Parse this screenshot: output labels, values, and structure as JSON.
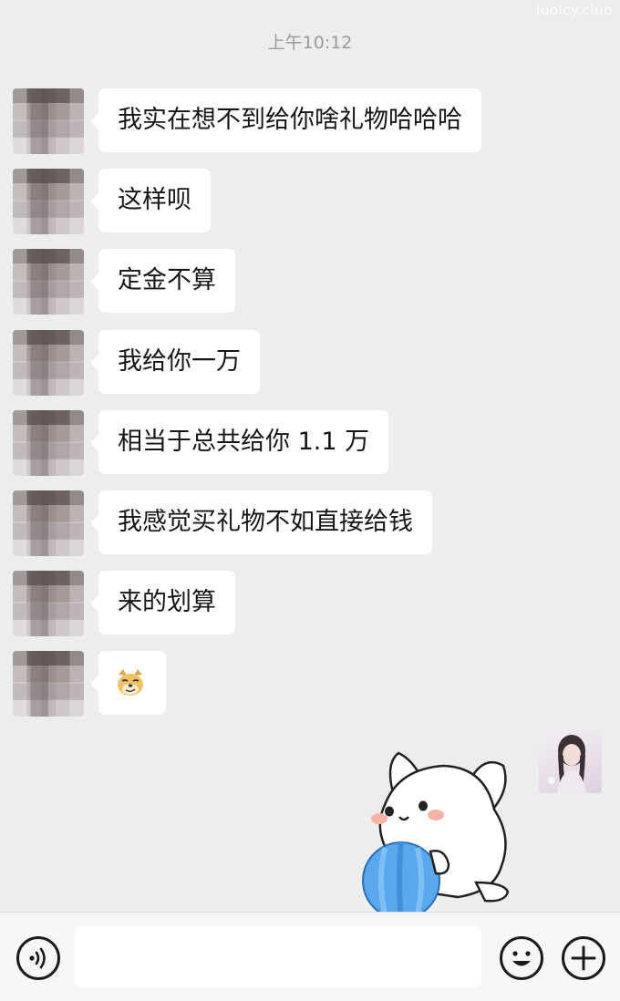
{
  "watermark": "luolcy.club",
  "timestamp": "上午10:12",
  "messages": [
    {
      "text": "我实在想不到给你啥礼物哈哈哈"
    },
    {
      "text": "这样呗"
    },
    {
      "text": "定金不算"
    },
    {
      "text": "我给你一万"
    },
    {
      "text": "相当于总共给你 1.1 万"
    },
    {
      "text": "我感觉买礼物不如直接给钱"
    },
    {
      "text": "来的划算"
    },
    {
      "sticker": "doge-emoji"
    }
  ],
  "self_message": {
    "sticker": "white-cat-with-blue-ball-sticker"
  },
  "input_bar": {
    "voice_icon": "voice-icon",
    "input_value": "",
    "emoji_icon": "smiley-icon",
    "more_icon": "plus-icon"
  },
  "colors": {
    "background": "#ededed",
    "bubble": "#ffffff",
    "timestamp": "#9a9a9a",
    "bottom_bar": "#f7f7f7"
  }
}
